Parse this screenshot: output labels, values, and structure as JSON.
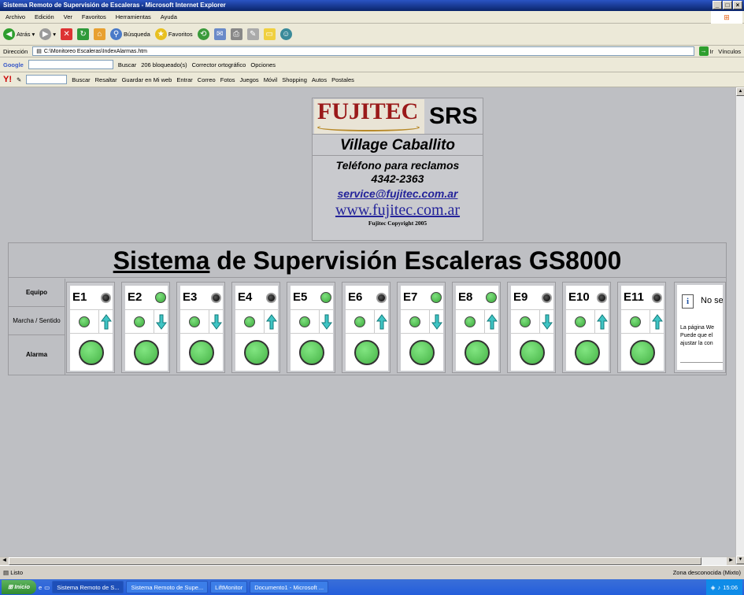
{
  "window": {
    "title": "Sistema Remoto de Supervisión de Escaleras - Microsoft Internet Explorer"
  },
  "menubar": {
    "items": [
      "Archivo",
      "Edición",
      "Ver",
      "Favoritos",
      "Herramientas",
      "Ayuda"
    ]
  },
  "toolbar": {
    "back": "Atrás",
    "search": "Búsqueda",
    "favorites": "Favoritos"
  },
  "address": {
    "label": "Dirección",
    "url": "C:\\Monitoreo Escaleras\\IndexAlarmas.htm",
    "go": "Ir",
    "links": "Vínculos"
  },
  "google_bar": {
    "logo": "Google",
    "search": "Buscar",
    "blocked": "206 bloqueado(s)",
    "spell": "Corrector ortográfico",
    "options": "Opciones"
  },
  "yahoo_bar": {
    "logo": "Y!",
    "search": "Buscar",
    "highlight": "Resaltar",
    "save": "Guardar en Mi web",
    "enter": "Entrar",
    "mail": "Correo",
    "photos": "Fotos",
    "games": "Juegos",
    "mobile": "Móvil",
    "shopping": "Shopping",
    "autos": "Autos",
    "cards": "Postales"
  },
  "header": {
    "brand": "FUJITEC",
    "product": "SRS",
    "site": "Village Caballito",
    "phone_label": "Teléfono para reclamos",
    "phone": "4342-2363",
    "email": "service@fujitec.com.ar",
    "web": "www.fujitec.com.ar",
    "copyright": "Fujitec Copyright 2005"
  },
  "main": {
    "title_underlined": "Sistema",
    "title_rest": " de Supervisión Escaleras GS8000",
    "row_labels": {
      "equipo": "Equipo",
      "marcha": "Marcha / Sentido",
      "alarma": "Alarma"
    }
  },
  "units": [
    {
      "name": "E1",
      "status": "black",
      "direction": "up"
    },
    {
      "name": "E2",
      "status": "green",
      "direction": "down"
    },
    {
      "name": "E3",
      "status": "black",
      "direction": "down"
    },
    {
      "name": "E4",
      "status": "black",
      "direction": "up"
    },
    {
      "name": "E5",
      "status": "green",
      "direction": "down"
    },
    {
      "name": "E6",
      "status": "black",
      "direction": "up"
    },
    {
      "name": "E7",
      "status": "green",
      "direction": "down"
    },
    {
      "name": "E8",
      "status": "green",
      "direction": "up"
    },
    {
      "name": "E9",
      "status": "black",
      "direction": "down"
    },
    {
      "name": "E10",
      "status": "black",
      "direction": "up"
    },
    {
      "name": "E11",
      "status": "black",
      "direction": "up"
    }
  ],
  "error_panel": {
    "title": "No se",
    "body1": "La página We",
    "body2": "Puede que el",
    "body3": "ajustar la con"
  },
  "statusbar": {
    "left": "Listo",
    "right": "Zona desconocida (Mixto)"
  },
  "taskbar": {
    "start": "Inicio",
    "tasks": [
      "Sistema Remoto de S...",
      "Sistema Remoto de Supe...",
      "LiftMonitor",
      "Documento1 - Microsoft ..."
    ],
    "clock": "15:06"
  },
  "colors": {
    "title_blue": "#0a246a",
    "page_bg": "#bebfc3",
    "green": "#45b245",
    "arrow_cyan": "#3fc4c4",
    "brand_red": "#9a1a1a",
    "link_blue": "#23239a"
  }
}
